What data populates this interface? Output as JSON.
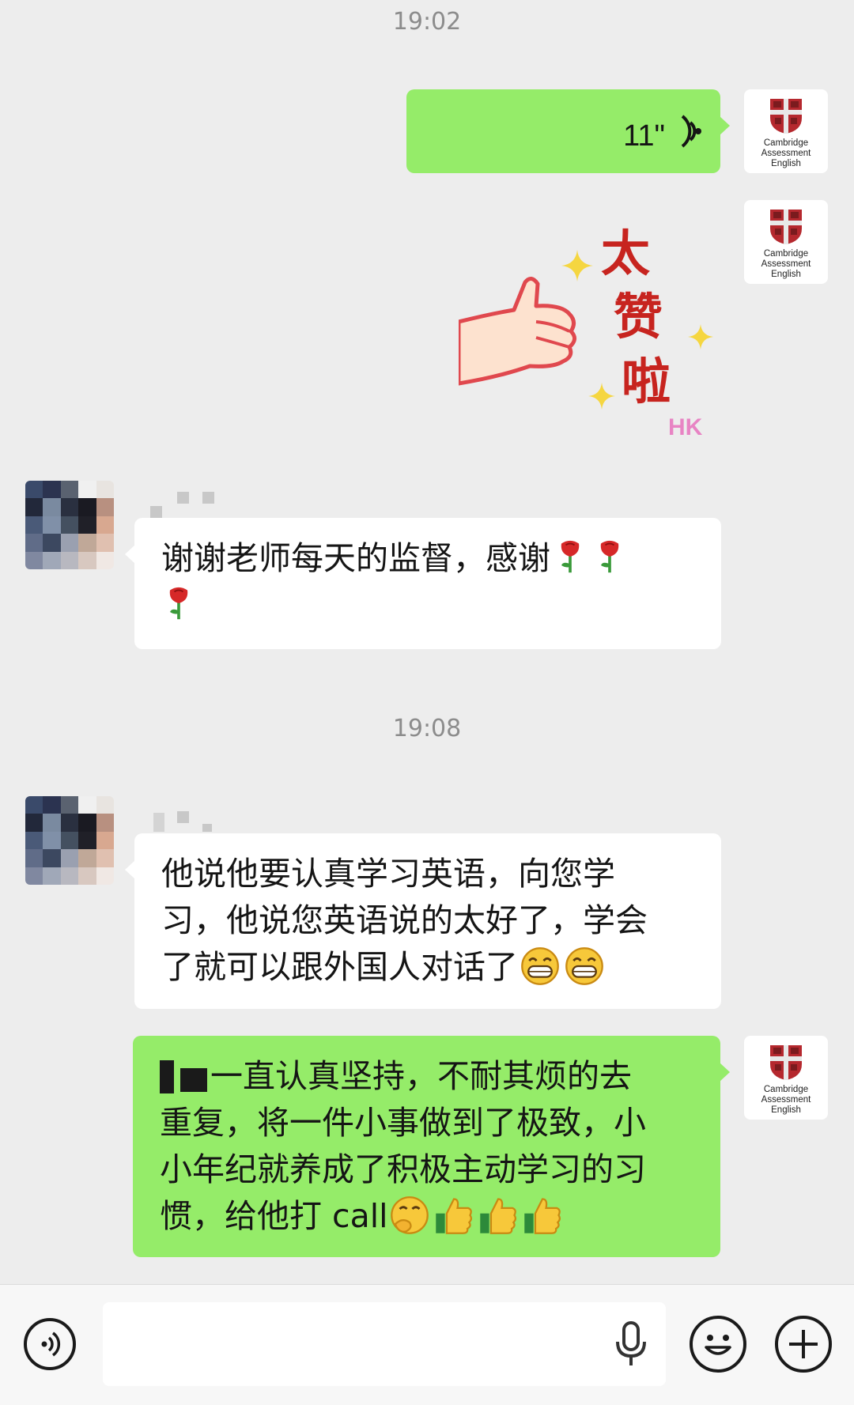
{
  "timestamps": [
    "19:02",
    "19:08"
  ],
  "avatar_me": {
    "line1": "Cambridge",
    "line2": "Assessment",
    "line3": "English"
  },
  "voice_message": {
    "duration": "11\""
  },
  "sticker": {
    "text_line1": "太",
    "text_line2": "赞",
    "text_line3": "啦",
    "brand": "HK"
  },
  "messages": {
    "m1": "谢谢老师每天的监督，感谢",
    "m2_line1": "他说他要认真学习英语，向您学",
    "m2_line2": "习，他说您英语说的太好了，学会",
    "m2_line3": "了就可以跟外国人对话了",
    "m3_line1": "一直认真坚持，不耐其烦的去",
    "m3_line2": "重复，将一件小事做到了极致，小",
    "m3_line3": "小年纪就养成了积极主动学习的习",
    "m3_line4": "惯，给他打 call"
  },
  "icons": [
    "voice-wave-icon",
    "rose-icon",
    "grin-emoji-icon",
    "thinking-emoji-icon",
    "thumbs-up-icon",
    "microphone-icon",
    "smiley-icon",
    "plus-icon",
    "voice-input-icon"
  ],
  "colors": {
    "green_bubble": "#95ec69",
    "background": "#ededed",
    "timestamp": "#8c8c8c"
  }
}
